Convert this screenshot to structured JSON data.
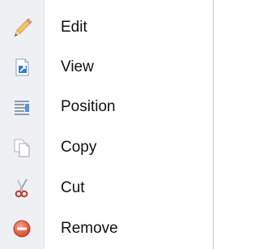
{
  "menu": {
    "items": [
      {
        "label": "Edit",
        "icon": "pencil-icon"
      },
      {
        "label": "View",
        "icon": "view-document-icon"
      },
      {
        "label": "Position",
        "icon": "position-lines-icon"
      },
      {
        "label": "Copy",
        "icon": "copy-pages-icon"
      },
      {
        "label": "Cut",
        "icon": "scissors-icon"
      },
      {
        "label": "Remove",
        "icon": "remove-icon"
      }
    ]
  }
}
